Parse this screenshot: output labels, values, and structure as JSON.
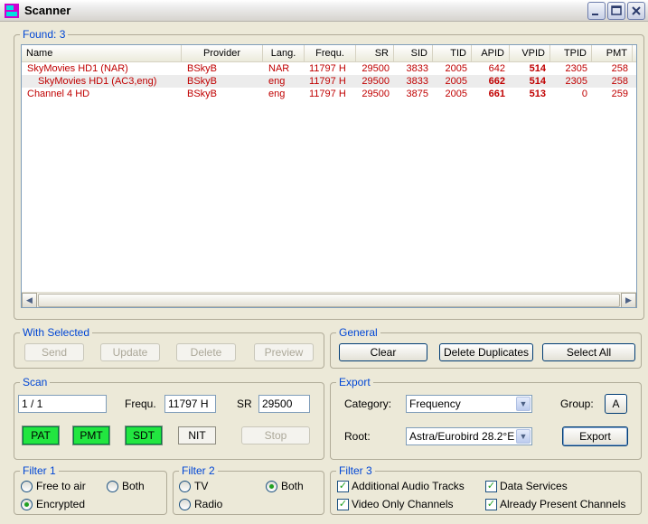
{
  "window": {
    "title": "Scanner"
  },
  "found": {
    "label": "Found:",
    "count": "3"
  },
  "columns": [
    "Name",
    "Provider",
    "Lang.",
    "Frequ.",
    "SR",
    "SID",
    "TID",
    "APID",
    "VPID",
    "TPID",
    "PMT"
  ],
  "rows": [
    {
      "name": "SkyMovies HD1 (NAR)",
      "provider": "BSkyB",
      "lang": "NAR",
      "frequ": "11797 H",
      "sr": "29500",
      "sid": "3833",
      "tid": "2005",
      "apid": "642",
      "vpid": "514",
      "tpid": "2305",
      "pmt": "258"
    },
    {
      "name": "SkyMovies HD1 (AC3,eng)",
      "provider": "BSkyB",
      "lang": "eng",
      "frequ": "11797 H",
      "sr": "29500",
      "sid": "3833",
      "tid": "2005",
      "apid": "662",
      "vpid": "514",
      "tpid": "2305",
      "pmt": "258"
    },
    {
      "name": "Channel 4 HD",
      "provider": "BSkyB",
      "lang": "eng",
      "frequ": "11797 H",
      "sr": "29500",
      "sid": "3875",
      "tid": "2005",
      "apid": "661",
      "vpid": "513",
      "tpid": "0",
      "pmt": "259"
    }
  ],
  "with_selected": {
    "title": "With Selected",
    "send": "Send",
    "update": "Update",
    "delete": "Delete",
    "preview": "Preview"
  },
  "general": {
    "title": "General",
    "clear": "Clear",
    "delete_duplicates": "Delete Duplicates",
    "select_all": "Select All"
  },
  "scan": {
    "title": "Scan",
    "progress": "1 / 1",
    "frequ_label": "Frequ.",
    "frequ_value": "11797 H",
    "sr_label": "SR",
    "sr_value": "29500",
    "pat": "PAT",
    "pmt": "PMT",
    "sdt": "SDT",
    "nit": "NIT",
    "stop": "Stop"
  },
  "export": {
    "title": "Export",
    "category_label": "Category:",
    "category_value": "Frequency",
    "group_label": "Group:",
    "group_value": "A",
    "root_label": "Root:",
    "root_value": "Astra/Eurobird 28.2°E",
    "export_button": "Export"
  },
  "filter1": {
    "title": "Filter 1",
    "free": "Free to air",
    "both": "Both",
    "encrypted": "Encrypted",
    "selected": "encrypted"
  },
  "filter2": {
    "title": "Filter 2",
    "tv": "TV",
    "both": "Both",
    "radio": "Radio",
    "selected": "both"
  },
  "filter3": {
    "title": "Filter 3",
    "audio": "Additional Audio Tracks",
    "data": "Data Services",
    "video": "Video Only Channels",
    "present": "Already Present Channels"
  },
  "colors": {
    "accent": "#0046d5",
    "row_text": "#c00000",
    "active_green": "#22e640"
  },
  "icons": {
    "app": "app-icon",
    "minimize": "minimize-icon",
    "maximize": "maximize-icon",
    "close": "close-icon"
  }
}
